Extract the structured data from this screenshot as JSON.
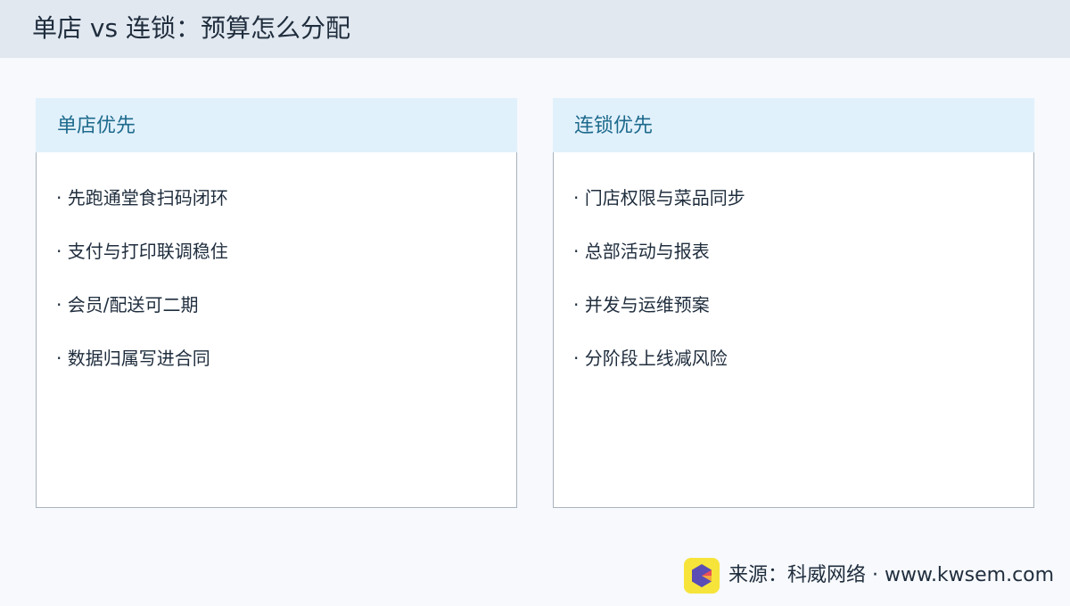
{
  "header": {
    "title": "单店 vs 连锁：预算怎么分配"
  },
  "cards": [
    {
      "title": "单店优先",
      "items": [
        "· 先跑通堂食扫码闭环",
        "· 支付与打印联调稳住",
        "· 会员/配送可二期",
        "· 数据归属写进合同"
      ]
    },
    {
      "title": "连锁优先",
      "items": [
        "· 门店权限与菜品同步",
        "· 总部活动与报表",
        "· 并发与运维预案",
        "· 分阶段上线减风险"
      ]
    }
  ],
  "footer": {
    "source": "来源：科威网络 · www.kwsem.com",
    "logo_icon": "kwsem-logo-icon",
    "logo_colors": [
      "#f6e43a",
      "#5b4db3",
      "#e94f5c",
      "#f4a73b"
    ]
  }
}
